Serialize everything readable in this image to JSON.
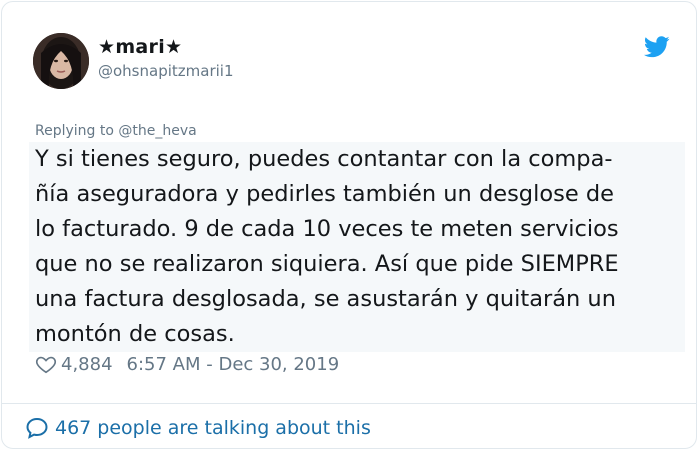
{
  "author": {
    "display_name": "★mari★",
    "handle": "@ohsnapitzmarii1"
  },
  "reply": {
    "prefix": "Replying to ",
    "mention": "@the_heva"
  },
  "tweet": {
    "lines": [
      "Y si tienes seguro, puedes contantar con la  compa-",
      "ñía aseguradora y pedirles también un desglose de",
      "lo facturado. 9 de cada 10 veces te meten servicios",
      "que no se realizaron siquiera. Así que pide SIEMPRE",
      "una factura desglosada, se asustarán y quitarán un",
      "montón de cosas."
    ]
  },
  "meta": {
    "likes": "4,884",
    "timestamp": "6:57 AM - Dec 30, 2019"
  },
  "footer": {
    "talking": "467 people are talking about this"
  },
  "colors": {
    "accent": "#1da1f2",
    "link": "#1b6fa8",
    "muted": "#657786",
    "text": "#14171a"
  },
  "icons": [
    "twitter-bird-icon",
    "heart-icon",
    "speech-bubble-icon"
  ]
}
